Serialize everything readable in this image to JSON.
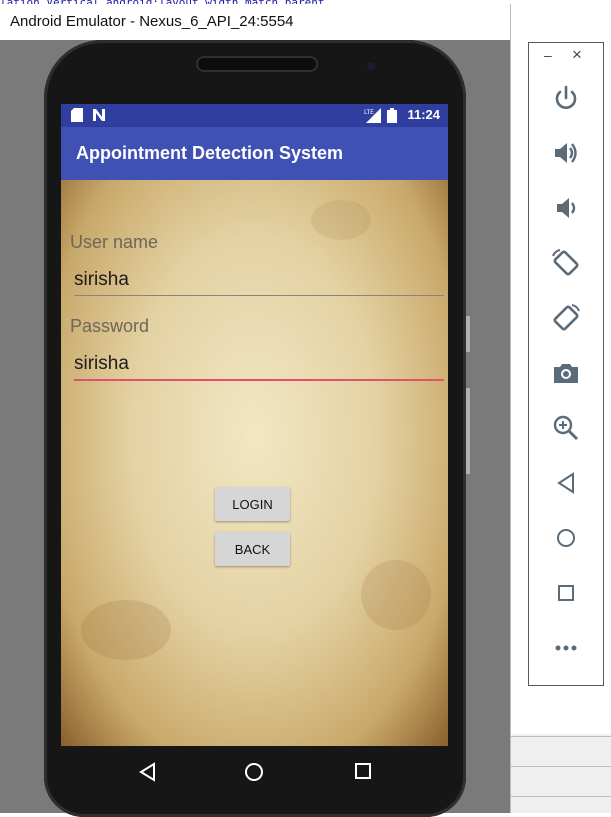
{
  "background_code": "lation  Vertical  android:layout_width  match_parent",
  "window": {
    "title": "Android Emulator - Nexus_6_API_24:5554"
  },
  "statusbar": {
    "time": "11:24",
    "icons": [
      "sd-card-icon",
      "n-icon",
      "lte-signal-icon",
      "battery-icon"
    ]
  },
  "appbar": {
    "title": "Appointment Detection System"
  },
  "form": {
    "username_label": "User name",
    "username_value": "sirisha",
    "password_label": "Password",
    "password_value": "sirisha"
  },
  "buttons": {
    "login": "LOGIN",
    "back": "BACK"
  },
  "navbar": [
    "back-nav-icon",
    "home-nav-icon",
    "recents-nav-icon"
  ],
  "side_panel": {
    "window_controls": [
      "minimize-icon",
      "close-icon"
    ],
    "minimize_glyph": "–",
    "close_glyph": "×",
    "controls": [
      "power-icon",
      "volume-up-icon",
      "volume-down-icon",
      "rotate-left-icon",
      "rotate-right-icon",
      "camera-icon",
      "zoom-icon",
      "back-icon",
      "home-icon",
      "overview-icon",
      "more-icon"
    ]
  },
  "colors": {
    "status_bar": "#303f9f",
    "app_bar": "#3f51b5",
    "focus_underline": "#e0526a",
    "button": "#d6d6d6"
  }
}
